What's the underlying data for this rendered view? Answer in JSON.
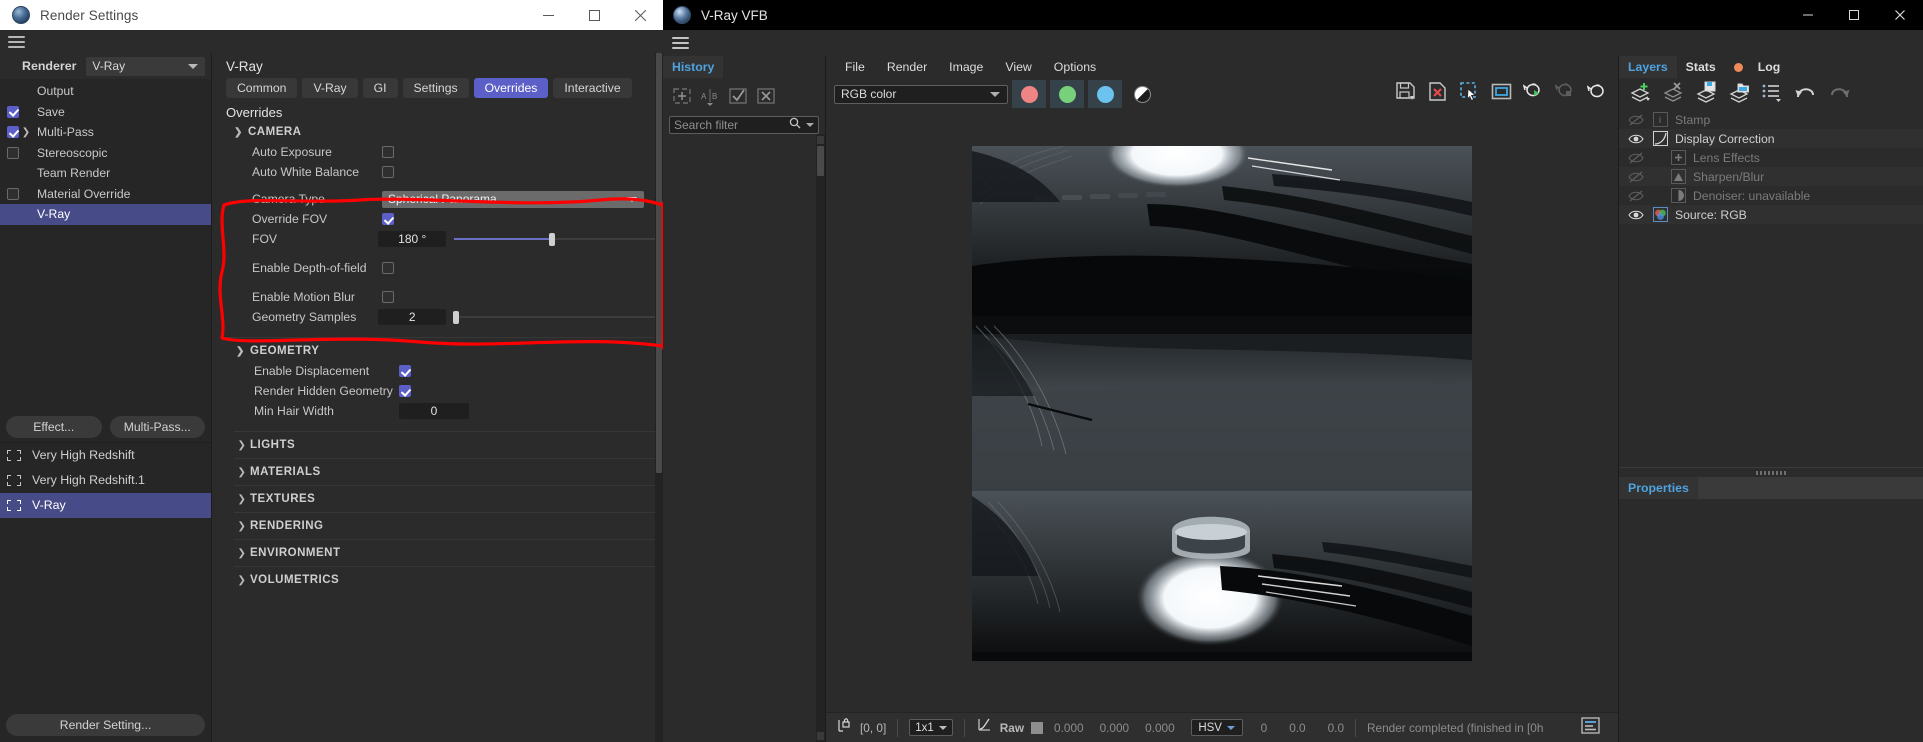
{
  "render_settings": {
    "window_title": "Render Settings",
    "window_buttons": {
      "minimize": "—",
      "maximize": "□",
      "close": "✕"
    },
    "renderer_label": "Renderer",
    "renderer_value": "V-Ray",
    "sidebar_items": [
      {
        "label": "Output",
        "checkbox": "none",
        "twisty": false,
        "selected": false
      },
      {
        "label": "Save",
        "checkbox": "checked",
        "twisty": false,
        "selected": false
      },
      {
        "label": "Multi-Pass",
        "checkbox": "checked",
        "twisty": true,
        "selected": false
      },
      {
        "label": "Stereoscopic",
        "checkbox": "unchecked",
        "twisty": false,
        "selected": false
      },
      {
        "label": "Team Render",
        "checkbox": "none",
        "twisty": false,
        "selected": false
      },
      {
        "label": "Material Override",
        "checkbox": "unchecked",
        "twisty": false,
        "selected": false
      },
      {
        "label": "V-Ray",
        "checkbox": "none",
        "twisty": false,
        "selected": true
      }
    ],
    "effect_button": "Effect...",
    "multipass_button": "Multi-Pass...",
    "scene_items": [
      {
        "label": "Very High Redshift",
        "selected": false
      },
      {
        "label": "Very High Redshift.1",
        "selected": false
      },
      {
        "label": "V-Ray",
        "selected": true
      }
    ],
    "render_setting_button": "Render Setting...",
    "panel_title": "V-Ray",
    "tabs": [
      {
        "label": "Common",
        "active": false
      },
      {
        "label": "V-Ray",
        "active": false
      },
      {
        "label": "GI",
        "active": false
      },
      {
        "label": "Settings",
        "active": false
      },
      {
        "label": "Overrides",
        "active": true
      },
      {
        "label": "Interactive",
        "active": false
      }
    ],
    "section_header": "Overrides",
    "camera_group": {
      "title": "CAMERA",
      "expanded": true,
      "auto_exposure": {
        "label": "Auto Exposure",
        "checked": false
      },
      "auto_white_balance": {
        "label": "Auto White Balance",
        "checked": false
      },
      "camera_type": {
        "label": "Camera Type",
        "value": "Spherical Panorama"
      },
      "override_fov": {
        "label": "Override FOV",
        "checked": true
      },
      "fov": {
        "label": "FOV",
        "value": "180 °",
        "slider_percent": 47
      },
      "enable_dof": {
        "label": "Enable Depth-of-field",
        "checked": false
      },
      "enable_motion_blur": {
        "label": "Enable Motion Blur",
        "checked": false
      },
      "geometry_samples": {
        "label": "Geometry Samples",
        "value": "2",
        "slider_percent": 1
      }
    },
    "geometry_group": {
      "title": "GEOMETRY",
      "expanded": true,
      "enable_displacement": {
        "label": "Enable Displacement",
        "checked": true
      },
      "render_hidden_geometry": {
        "label": "Render Hidden Geometry",
        "checked": true
      },
      "min_hair_width": {
        "label": "Min Hair Width",
        "value": "0"
      }
    },
    "collapsed_groups": [
      "LIGHTS",
      "MATERIALS",
      "TEXTURES",
      "RENDERING",
      "ENVIRONMENT",
      "VOLUMETRICS"
    ],
    "annotation_color": "#ff0000"
  },
  "vfb": {
    "window_title": "V-Ray VFB",
    "window_buttons": {
      "minimize": "—",
      "maximize": "□",
      "close": "✕"
    },
    "history": {
      "tab_label": "History",
      "search_placeholder": "Search filter",
      "tool_icons": [
        "add-to-history-icon",
        "compare-ab-icon",
        "select-history-icon",
        "remove-history-icon"
      ]
    },
    "menus": [
      "File",
      "Render",
      "Image",
      "View",
      "Options"
    ],
    "channel_select": "RGB color",
    "channel_buttons": [
      "red-channel-button",
      "green-channel-button",
      "blue-channel-button"
    ],
    "alpha_icon": "alpha-channel-icon",
    "toolbar_icons": [
      "save-image-icon",
      "clear-image-icon",
      "region-render-icon",
      "region-select-icon",
      "start-render-icon",
      "stop-render-icon",
      "rerender-icon"
    ],
    "status": {
      "lock_icon": "pixel-lock-icon",
      "coordinates": "[0, 0]",
      "sample_size": "1x1",
      "curve_icon": "color-curve-icon",
      "raw_label": "Raw",
      "raw_swatch": "#8e8e8e",
      "raw_values": [
        "0.000",
        "0.000",
        "0.000"
      ],
      "color_mode": "HSV",
      "hsv_values": [
        "0",
        "0.0",
        "0.0"
      ],
      "message": "Render completed (finished in [0h",
      "log_icon": "log-panel-icon"
    },
    "layers_panel": {
      "tabs": [
        {
          "label": "Layers",
          "active": true,
          "dot": false
        },
        {
          "label": "Stats",
          "active": false,
          "dot": false
        },
        {
          "label": "Log",
          "active": false,
          "dot": true,
          "dot_color": "#ef8a5a"
        }
      ],
      "toolbar_icons": [
        "add-layer-icon",
        "delete-layer-icon",
        "save-layers-icon",
        "load-layers-icon",
        "layer-list-icon",
        "undo-icon",
        "redo-icon"
      ],
      "rows": [
        {
          "label": "Stamp",
          "visible": false,
          "indent": false,
          "thumb": "info-icon"
        },
        {
          "label": "Display Correction",
          "visible": true,
          "indent": false,
          "thumb": "curve-icon"
        },
        {
          "label": "Lens Effects",
          "visible": false,
          "indent": true,
          "thumb": "plus-icon"
        },
        {
          "label": "Sharpen/Blur",
          "visible": false,
          "indent": true,
          "thumb": "sharpen-icon"
        },
        {
          "label": "Denoiser: unavailable",
          "visible": false,
          "indent": true,
          "thumb": "denoise-icon"
        },
        {
          "label": "Source: RGB",
          "visible": true,
          "indent": false,
          "thumb": "rgb-icon"
        }
      ]
    },
    "properties_panel": {
      "tab_label": "Properties"
    }
  }
}
